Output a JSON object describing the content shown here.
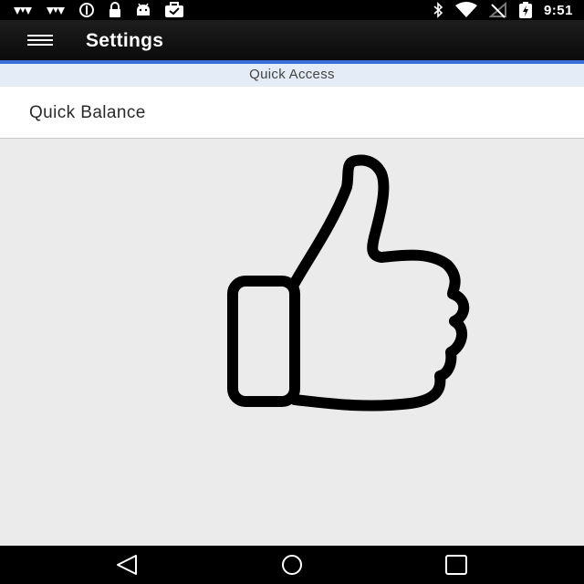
{
  "status_bar": {
    "time": "9:51",
    "left_icons": [
      "signal-bars-icon",
      "signal-bars-icon",
      "data-usage-icon",
      "lock-icon",
      "android-icon",
      "briefcase-check-icon"
    ],
    "right_icons": [
      "bluetooth-icon",
      "wifi-icon",
      "no-signal-icon",
      "battery-charging-icon"
    ]
  },
  "app_bar": {
    "menu_icon": "hamburger-menu-icon",
    "title": "Settings",
    "accent_color": "#3a6fd8"
  },
  "section": {
    "header": "Quick Access"
  },
  "list": {
    "items": [
      {
        "label": "Quick Balance"
      }
    ]
  },
  "illustration": {
    "icon": "thumbs-up-icon"
  },
  "nav_bar": {
    "buttons": [
      "back-icon",
      "home-icon",
      "recents-icon"
    ]
  }
}
